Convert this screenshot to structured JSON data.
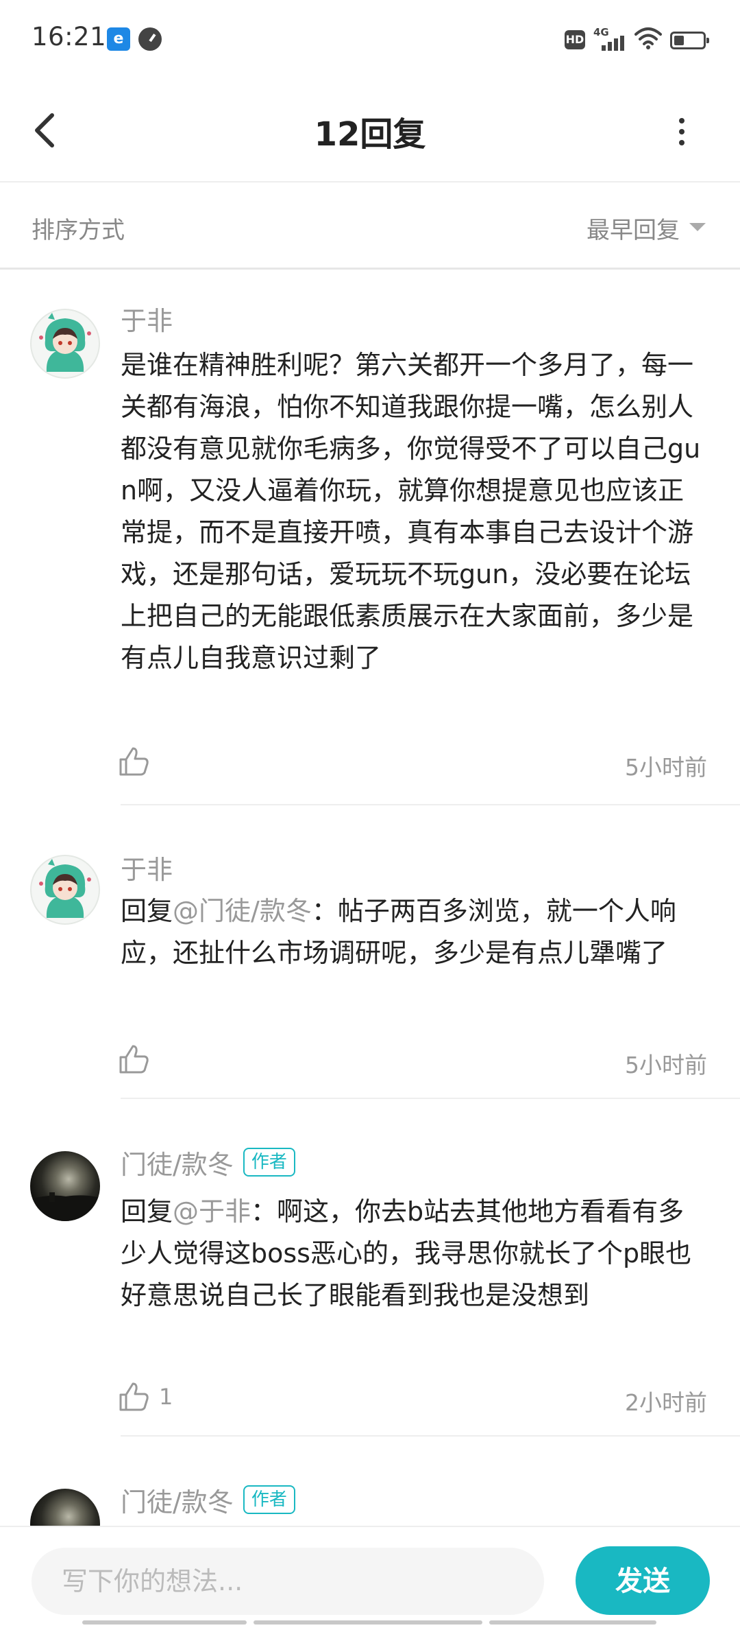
{
  "status_bar": {
    "time": "16:21",
    "network": "4G"
  },
  "header": {
    "title": "12回复"
  },
  "sort": {
    "label": "排序方式",
    "selected": "最早回复"
  },
  "comments": [
    {
      "username": "于非",
      "is_author": false,
      "avatar": "anime-avatar",
      "mention_prefix": "",
      "mention": "",
      "text": "是谁在精神胜利呢？第六关都开一个多月了，每一关都有海浪，怕你不知道我跟你提一嘴，怎么别人都没有意见就你毛病多，你觉得受不了可以自己gun啊，又没人逼着你玩，就算你想提意见也应该正常提，而不是直接开喷，真有本事自己去设计个游戏，还是那句话，爱玩玩不玩gun，没必要在论坛上把自己的无能跟低素质展示在大家面前，多少是有点儿自我意识过剩了",
      "likes": "",
      "time": "5小时前"
    },
    {
      "username": "于非",
      "is_author": false,
      "avatar": "anime-avatar",
      "mention_prefix": "回复",
      "mention": "@门徒/款冬",
      "text": "：帖子两百多浏览，就一个人响应，还扯什么市场调研呢，多少是有点儿犟嘴了",
      "likes": "",
      "time": "5小时前"
    },
    {
      "username": "门徒/款冬",
      "is_author": true,
      "author_badge": "作者",
      "avatar": "dark-photo-avatar",
      "mention_prefix": "回复",
      "mention": "@于非",
      "text": "：啊这，你去b站去其他地方看看有多少人觉得这boss恶心的，我寻思你就长了个p眼也好意思说自己长了眼能看到我也是没想到",
      "likes": "1",
      "time": "2小时前"
    },
    {
      "username": "门徒/款冬",
      "is_author": true,
      "author_badge": "作者",
      "avatar": "dark-photo-avatar"
    }
  ],
  "input": {
    "placeholder": "写下你的想法...",
    "send_label": "发送"
  },
  "colors": {
    "accent": "#19b8c2",
    "secondary_text": "#999999",
    "primary_text": "#222222"
  }
}
